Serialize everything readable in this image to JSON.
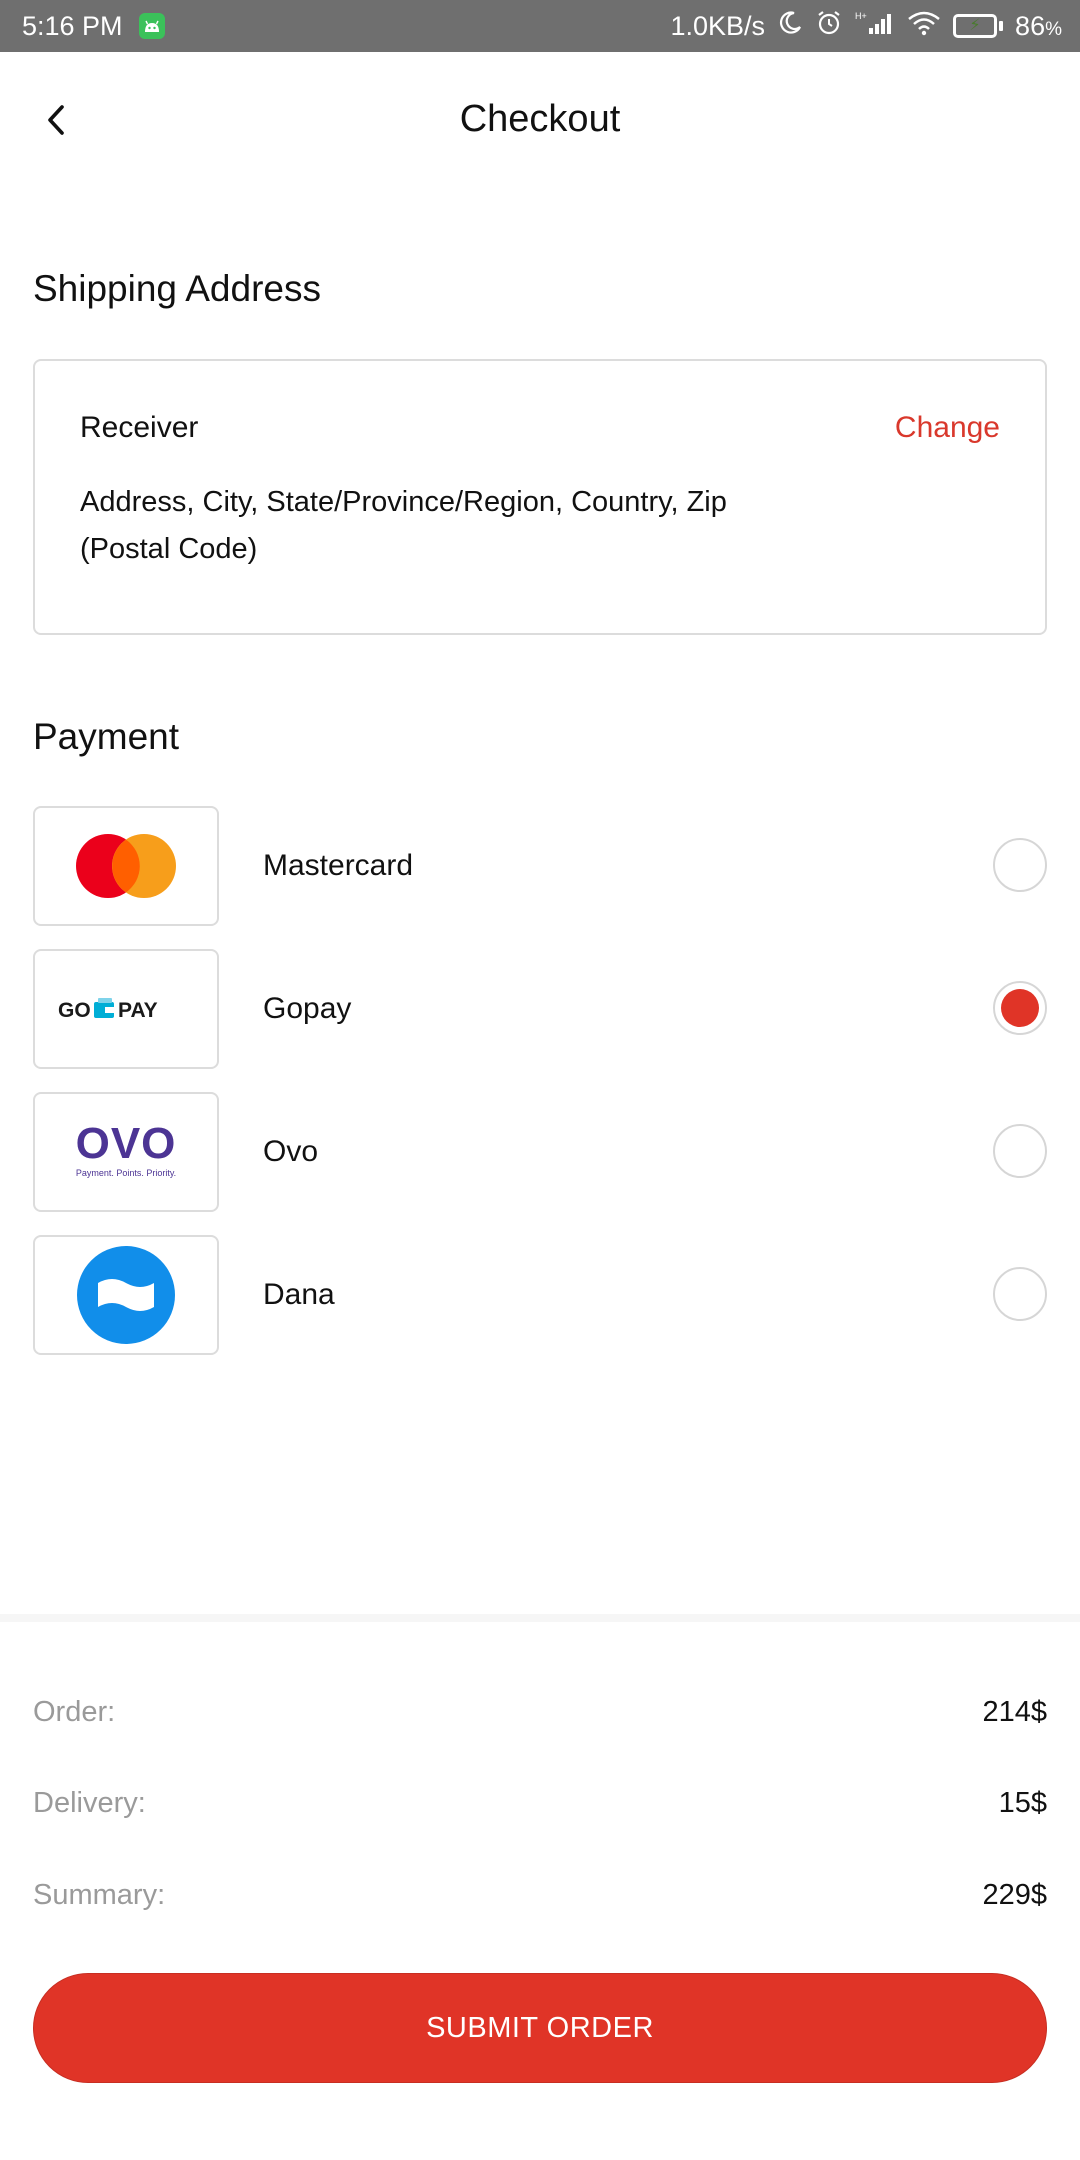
{
  "status_bar": {
    "time": "5:16 PM",
    "network_speed": "1.0KB/s",
    "battery_pct": "86",
    "battery_unit": "%",
    "battery_level": 0.86,
    "icons": [
      "android-notification-icon",
      "moon-icon",
      "alarm-icon",
      "signal-icon",
      "wifi-icon",
      "battery-icon"
    ]
  },
  "header": {
    "title": "Checkout",
    "back_icon": "chevron-left-icon"
  },
  "shipping": {
    "section_title": "Shipping Address",
    "receiver_label": "Receiver",
    "change_label": "Change",
    "address": "Address, City, State/Province/Region, Country, Zip (Postal Code)"
  },
  "payment": {
    "section_title": "Payment",
    "options": [
      {
        "label": "Mastercard",
        "logo": "mastercard-logo",
        "selected": false
      },
      {
        "label": "Gopay",
        "logo": "gopay-logo",
        "logo_text_left": "GO",
        "logo_text_right": "PAY",
        "selected": true
      },
      {
        "label": "Ovo",
        "logo": "ovo-logo",
        "logo_text": "OVO",
        "logo_tagline": "Payment. Points. Priority.",
        "selected": false
      },
      {
        "label": "Dana",
        "logo": "dana-logo",
        "selected": false
      }
    ]
  },
  "summary": {
    "order_label": "Order:",
    "order_value": "214$",
    "delivery_label": "Delivery:",
    "delivery_value": "15$",
    "summary_label": "Summary:",
    "summary_value": "229$"
  },
  "submit_label": "SUBMIT ORDER",
  "colors": {
    "accent": "#e03427",
    "status_bar": "#6f6f6f",
    "mastercard_red": "#eb001b",
    "mastercard_orange": "#f79e1b",
    "ovo_purple": "#4c3494",
    "dana_blue": "#118eea",
    "gopay_blue": "#00aed6"
  }
}
